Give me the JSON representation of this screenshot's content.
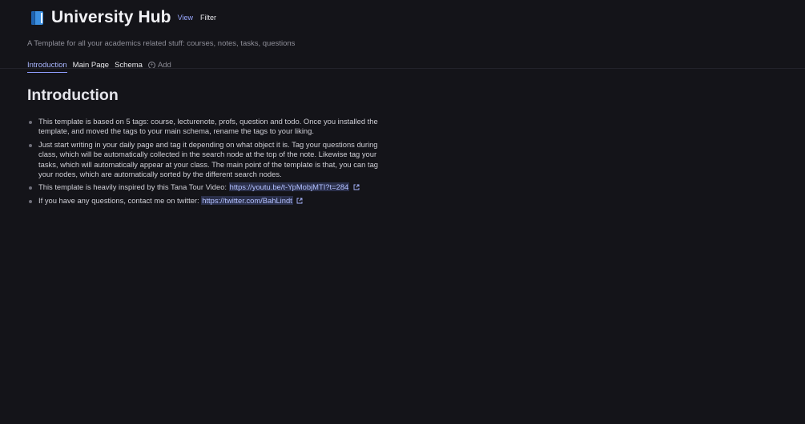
{
  "header": {
    "icon": "blue-book-icon",
    "title": "University Hub",
    "view_label": "View",
    "filter_label": "Filter",
    "subtitle": "A Template for all your academics related stuff: courses, notes, tasks, questions"
  },
  "tabs": [
    {
      "label": "Introduction",
      "active": true
    },
    {
      "label": "Main Page",
      "active": false
    },
    {
      "label": "Schema",
      "active": false
    }
  ],
  "add_tab_label": "Add",
  "content": {
    "heading": "Introduction",
    "bullets": [
      {
        "text": "This template is based on 5 tags: course, lecturenote, profs, question and todo. Once you installed the template, and moved the tags to your main schema, rename the tags to your liking."
      },
      {
        "text": "Just start writing in your daily page and tag it depending on what object it is. Tag your questions during class, which will be automatically collected in the search node at the top of the note. Likewise tag your tasks, which will automatically appear at your class. The main point of the template is that, you can tag your nodes, which are automatically sorted by the different search nodes."
      },
      {
        "text": "This template is heavily inspired by this Tana Tour Video: ",
        "link": "https://youtu.be/t-YpMobjMTI?t=284"
      },
      {
        "text": "If you have any questions, contact me on twitter: ",
        "link": "https://twitter.com/BahLindt"
      }
    ]
  },
  "colors": {
    "background": "#141419",
    "accent": "#a9b6ff",
    "link_bg": "#2a2f4a",
    "book_icon": "#3b8fe0"
  }
}
